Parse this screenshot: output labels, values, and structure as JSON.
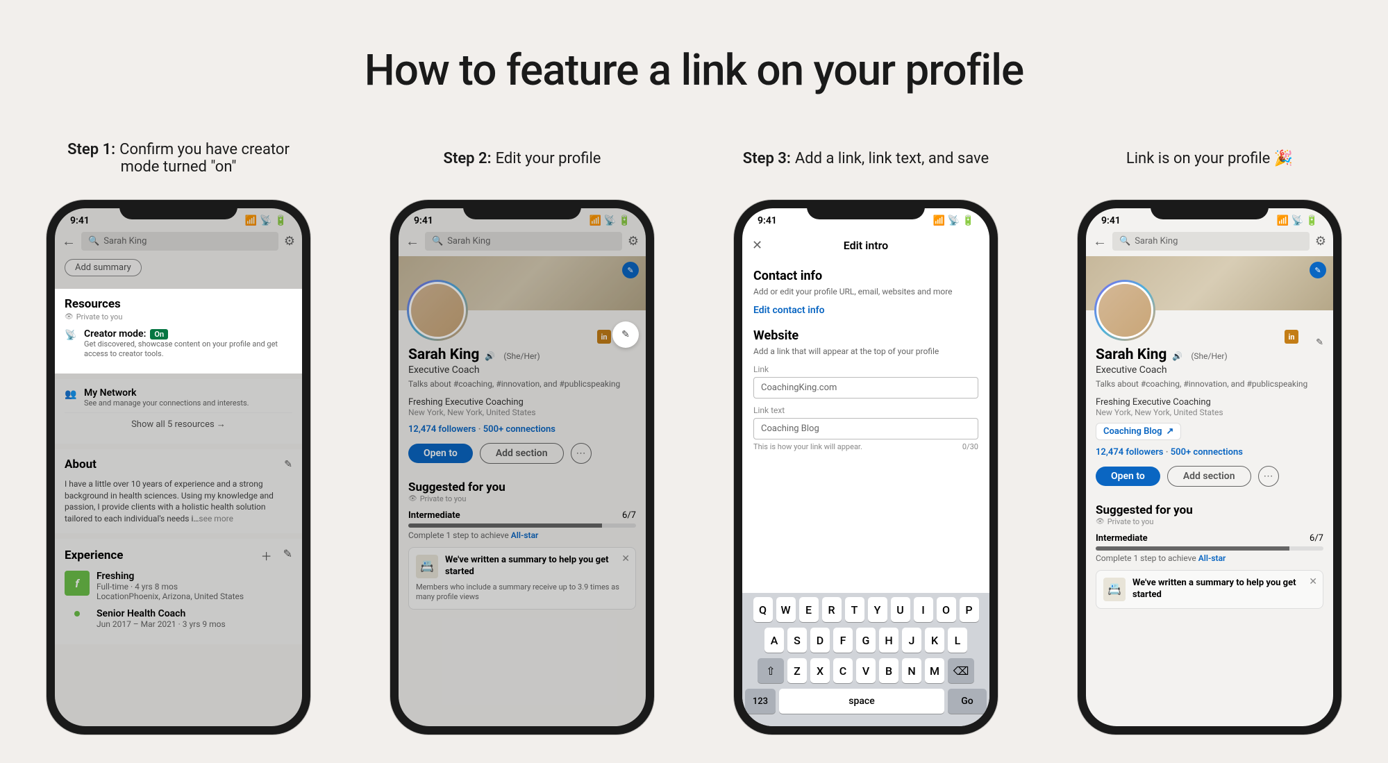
{
  "title": "How to feature a link on your profile",
  "steps": {
    "s1": {
      "label_prefix": "Step 1:",
      "label_text": "Confirm you have creator mode turned \"on\""
    },
    "s2": {
      "label_prefix": "Step 2:",
      "label_text": "Edit your profile"
    },
    "s3": {
      "label_prefix": "Step 3:",
      "label_text": "Add a link, link text, and save"
    },
    "s4": {
      "label_text": "Link is on your profile 🎉"
    }
  },
  "statusbar": {
    "time": "9:41"
  },
  "search": {
    "name": "Sarah King"
  },
  "step1": {
    "add_summary": "Add summary",
    "resources_title": "Resources",
    "private": "Private to you",
    "creator_mode_label": "Creator mode:",
    "creator_mode_badge": "On",
    "creator_mode_desc": "Get discovered, showcase content on your profile and get access to creator tools.",
    "my_network_title": "My Network",
    "my_network_desc": "See and manage your connections and interests.",
    "show_all": "Show all 5 resources  →",
    "about_title": "About",
    "about_text": "I have a little over 10 years of experience and a strong background in health sciences. Using my knowledge and passion, I provide clients with a holistic health solution tailored to each individual's needs i…",
    "see_more": "see more",
    "experience_title": "Experience",
    "exp1_title": "Freshing",
    "exp1_sub": "Full-time · 4 yrs 8 mos",
    "exp1_loc": "LocationPhoenix, Arizona, United States",
    "exp2_title": "Senior Health Coach",
    "exp2_sub": "Jun 2017 – Mar 2021 · 3 yrs 9 mos"
  },
  "profile": {
    "name": "Sarah King",
    "pronouns": "(She/Her)",
    "role": "Executive Coach",
    "talks": "Talks about #coaching, #innovation, and #publicspeaking",
    "company": "Freshing Executive Coaching",
    "location": "New York, New York, United States",
    "followers": "12,474 followers",
    "connections": "500+ connections",
    "open_to": "Open to",
    "add_section": "Add section",
    "blog_chip": "Coaching Blog",
    "suggested_title": "Suggested for you",
    "private": "Private to you",
    "intermediate": "Intermediate",
    "progress": "6/7",
    "complete_text": "Complete 1 step to achieve ",
    "allstar": "All-star",
    "summary_card_title": "We've written a summary to help you get started",
    "summary_card_body": "Members who include a summary receive up to 3.9 times as many profile views"
  },
  "edit_intro": {
    "title": "Edit intro",
    "contact_h": "Contact info",
    "contact_sub": "Add or edit your profile URL, email, websites and more",
    "edit_contact": "Edit contact info",
    "website_h": "Website",
    "website_sub": "Add a link that will appear at the top of your profile",
    "link_label": "Link",
    "link_value": "CoachingKing.com",
    "linktext_label": "Link text",
    "linktext_value": "Coaching Blog",
    "help_left": "This is how your link will appear.",
    "help_right": "0/30"
  },
  "keyboard": {
    "row1": [
      "Q",
      "W",
      "E",
      "R",
      "T",
      "Y",
      "U",
      "I",
      "O",
      "P"
    ],
    "row2": [
      "A",
      "S",
      "D",
      "F",
      "G",
      "H",
      "J",
      "K",
      "L"
    ],
    "row3": [
      "Z",
      "X",
      "C",
      "V",
      "B",
      "N",
      "M"
    ],
    "num": "123",
    "space": "space",
    "go": "Go"
  }
}
